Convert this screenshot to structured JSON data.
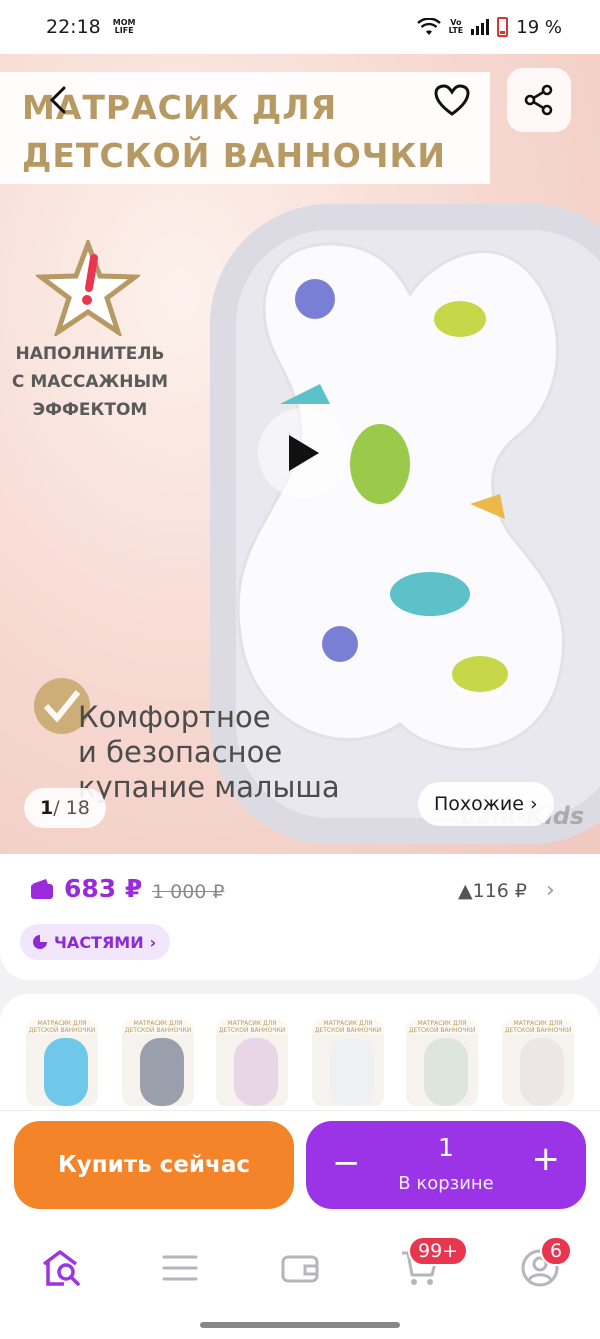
{
  "status": {
    "time": "22:18",
    "app_badge_line1": "MOM",
    "app_badge_line2": "LIFE",
    "battery": "19 %",
    "net_label_line1": "Vo",
    "net_label_line2": "LTE"
  },
  "hero": {
    "title_line1": "МАТРАСИК ДЛЯ",
    "title_line2": "ДЕТСКОЙ ВАННОЧКИ",
    "feature_line1": "НАПОЛНИТЕЛЬ",
    "feature_line2": "С МАССАЖНЫМ",
    "feature_line3": "ЭФФЕКТОМ",
    "slogan_line1": "Комфортное",
    "slogan_line2": "и безопасное",
    "slogan_line3": "купание малыша",
    "counter_current": "1",
    "counter_total": "/ 18",
    "similar_label": "Похожие",
    "similar_chevron": "›",
    "watermark": "Lala-Kids"
  },
  "price": {
    "current": "683 ₽",
    "old": "1 000 ₽",
    "diff": "▲116 ₽",
    "chevron": "›",
    "parts_label": "ЧАСТЯМИ",
    "parts_chevron": "›"
  },
  "variants": {
    "thumb_caption": "МАТРАСИК ДЛЯ ДЕТСКОЙ ВАННОЧКИ"
  },
  "actions": {
    "buy_label": "Купить сейчас",
    "minus": "−",
    "plus": "+",
    "quantity": "1",
    "in_cart_label": "В корзине"
  },
  "nav": {
    "cart_badge": "99+",
    "profile_badge": "6"
  },
  "colors": {
    "accent_purple": "#9b34e6",
    "buy_orange": "#f48429",
    "badge_red": "#e8364f",
    "price_purple": "#9a2bdc"
  }
}
